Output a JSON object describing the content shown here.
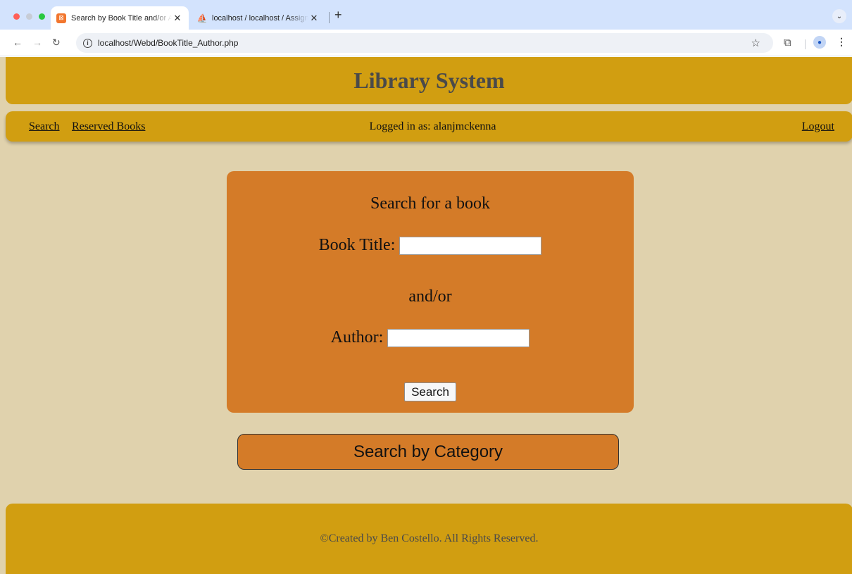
{
  "browser": {
    "tabs": [
      {
        "title": "Search by Book Title and/or Author",
        "active": true
      },
      {
        "title": "localhost / localhost / Assignment",
        "active": false
      }
    ],
    "new_tab_label": "+",
    "tab_close_glyph": "✕",
    "address": "localhost/Webd/BookTitle_Author.php",
    "icons": [
      "back-arrow-icon",
      "forward-arrow-icon",
      "reload-icon",
      "info-icon",
      "star-icon",
      "extensions-icon",
      "profile-icon",
      "more-vert-icon",
      "tab-search-icon"
    ]
  },
  "site": {
    "title": "Library System",
    "nav": {
      "search": "Search",
      "reserved": "Reserved Books",
      "logged_in": "Logged in as: alanjmckenna",
      "logout": "Logout"
    },
    "search_form": {
      "heading": "Search for a book",
      "title_label": "Book Title:",
      "title_value": "",
      "separator": "and/or",
      "author_label": "Author:",
      "author_value": "",
      "submit_label": "Search"
    },
    "category_button": "Search by Category",
    "footer": "©Created by Ben Costello. All Rights Reserved."
  },
  "colors": {
    "header": "#d19e11",
    "page_background": "#e0d2ad",
    "card": "#d47b28"
  }
}
